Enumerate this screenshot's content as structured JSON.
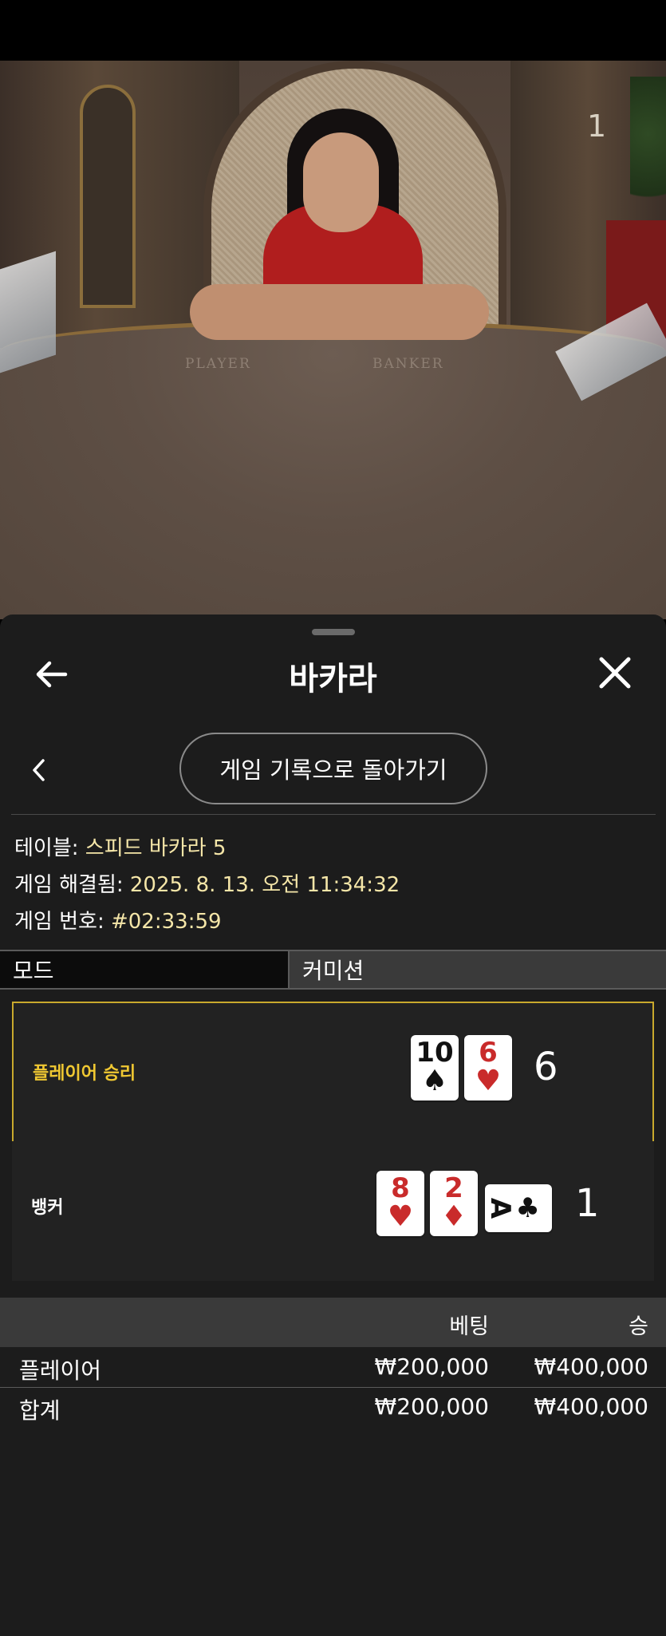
{
  "video": {
    "camera_number": "1",
    "felt_player": "PLAYER",
    "felt_banker": "BANKER"
  },
  "sheet": {
    "title": "바카라",
    "back_icon": "arrow-left-icon",
    "close_icon": "close-x-icon",
    "history_button": "게임 기록으로 돌아가기"
  },
  "info": {
    "table_label": "테이블: ",
    "table_value": "스피드 바카라 5",
    "resolved_label": "게임 해결됨: ",
    "resolved_value": "2025. 8. 13. 오전 11:34:32",
    "number_label": "게임 번호: ",
    "number_value": "#02:33:59"
  },
  "tabs": {
    "mode": "모드",
    "commission": "커미션"
  },
  "results": {
    "player": {
      "label": "플레이어 승리",
      "cards": [
        {
          "rank": "10",
          "suit": "♠",
          "color": "black"
        },
        {
          "rank": "6",
          "suit": "♥",
          "color": "red"
        }
      ],
      "score": "6"
    },
    "banker": {
      "label": "뱅커",
      "cards": [
        {
          "rank": "8",
          "suit": "♥",
          "color": "red"
        },
        {
          "rank": "2",
          "suit": "♦",
          "color": "red"
        },
        {
          "rank": "A",
          "suit": "♣",
          "color": "black",
          "sideways": true
        }
      ],
      "score": "1"
    }
  },
  "bets": {
    "col_bet": "베팅",
    "col_win": "승",
    "rows": [
      {
        "label": "플레이어",
        "bet": "₩200,000",
        "win": "₩400,000"
      },
      {
        "label": "합계",
        "bet": "₩200,000",
        "win": "₩400,000"
      }
    ]
  },
  "colors": {
    "sheet_bg": "#1c1c1c",
    "accent_gold": "#c9a92d",
    "info_value": "#f5e6a8",
    "card_red": "#c92b2b"
  }
}
